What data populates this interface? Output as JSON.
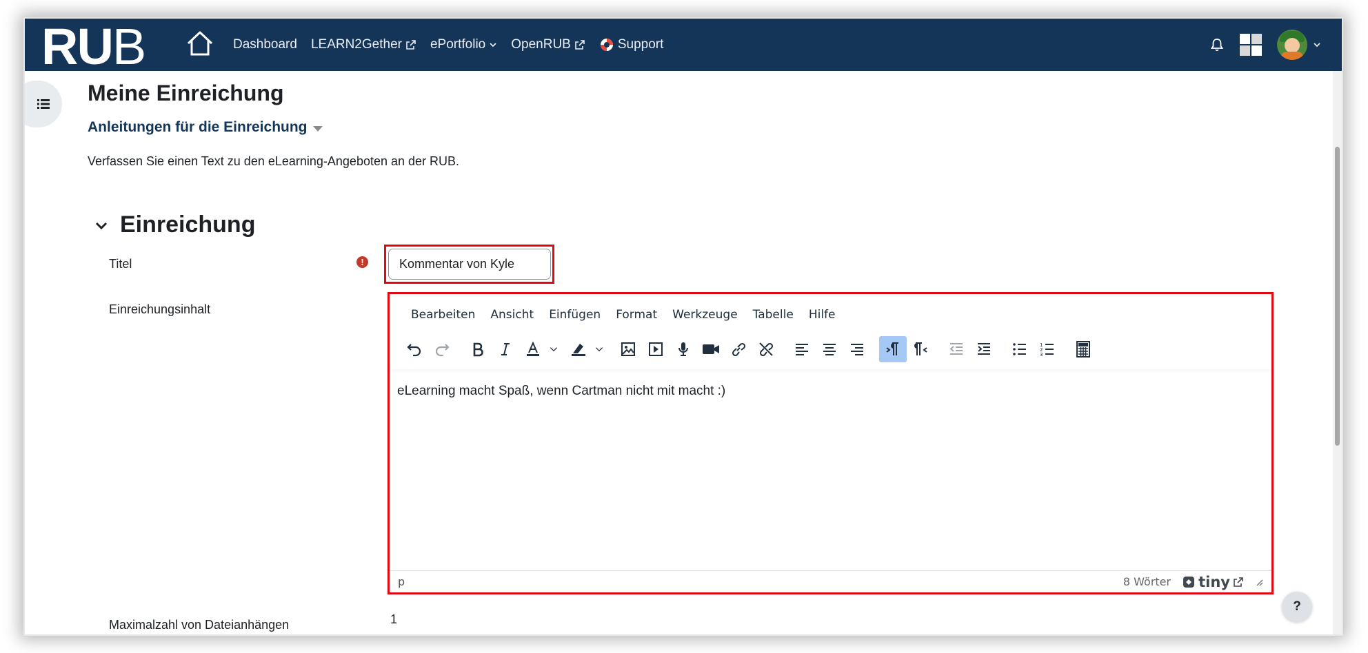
{
  "navbar": {
    "logo_part1": "RU",
    "logo_part2": "B",
    "links": [
      "Dashboard",
      "LEARN2Gether",
      "ePortfolio",
      "OpenRUB",
      "Support"
    ]
  },
  "page": {
    "title": "Meine Einreichung",
    "instructions_toggle": "Anleitungen für die Einreichung",
    "description": "Verfassen Sie einen Text zu den eLearning-Angeboten an der RUB."
  },
  "section": {
    "title": "Einreichung"
  },
  "form": {
    "title_label": "Titel",
    "title_value": "Kommentar von Kyle",
    "content_label": "Einreichungsinhalt",
    "max_attachments_label": "Maximalzahl von Dateianhängen",
    "max_attachments_value": "1",
    "required_icon_text": "!"
  },
  "editor": {
    "menu": [
      "Bearbeiten",
      "Ansicht",
      "Einfügen",
      "Format",
      "Werkzeuge",
      "Tabelle",
      "Hilfe"
    ],
    "content": "eLearning macht Spaß, wenn Cartman nicht mit macht :)",
    "status_path": "p",
    "word_count": "8 Wörter",
    "brand": "tiny"
  },
  "help_button": "?",
  "colors": {
    "navbar": "#143458",
    "link": "#143458",
    "highlight_border": "#e30613",
    "toolbar_active": "#a6c8f4"
  }
}
